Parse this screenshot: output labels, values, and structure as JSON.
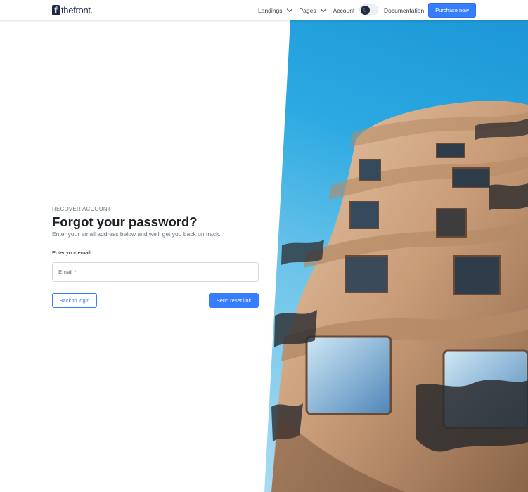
{
  "header": {
    "logo_letter": "f",
    "logo_text": "thefront.",
    "nav": [
      {
        "label": "Landings"
      },
      {
        "label": "Pages"
      },
      {
        "label": "Account"
      }
    ],
    "documentation_label": "Documentation",
    "purchase_label": "Purchase now"
  },
  "form": {
    "eyebrow": "RECOVER ACCOUNT",
    "title": "Forgot your password?",
    "subtitle": "Enter your email address below and we'll get you back on track.",
    "email_label": "Enter your email",
    "email_placeholder": "Email *",
    "email_value": "",
    "back_label": "Back to login",
    "send_label": "Send reset link"
  },
  "colors": {
    "primary": "#377dff",
    "text_dark": "#1e2022",
    "text_muted": "#677788"
  },
  "icons": [
    "theme-toggle-moon-icon",
    "chevron-down-icon"
  ]
}
